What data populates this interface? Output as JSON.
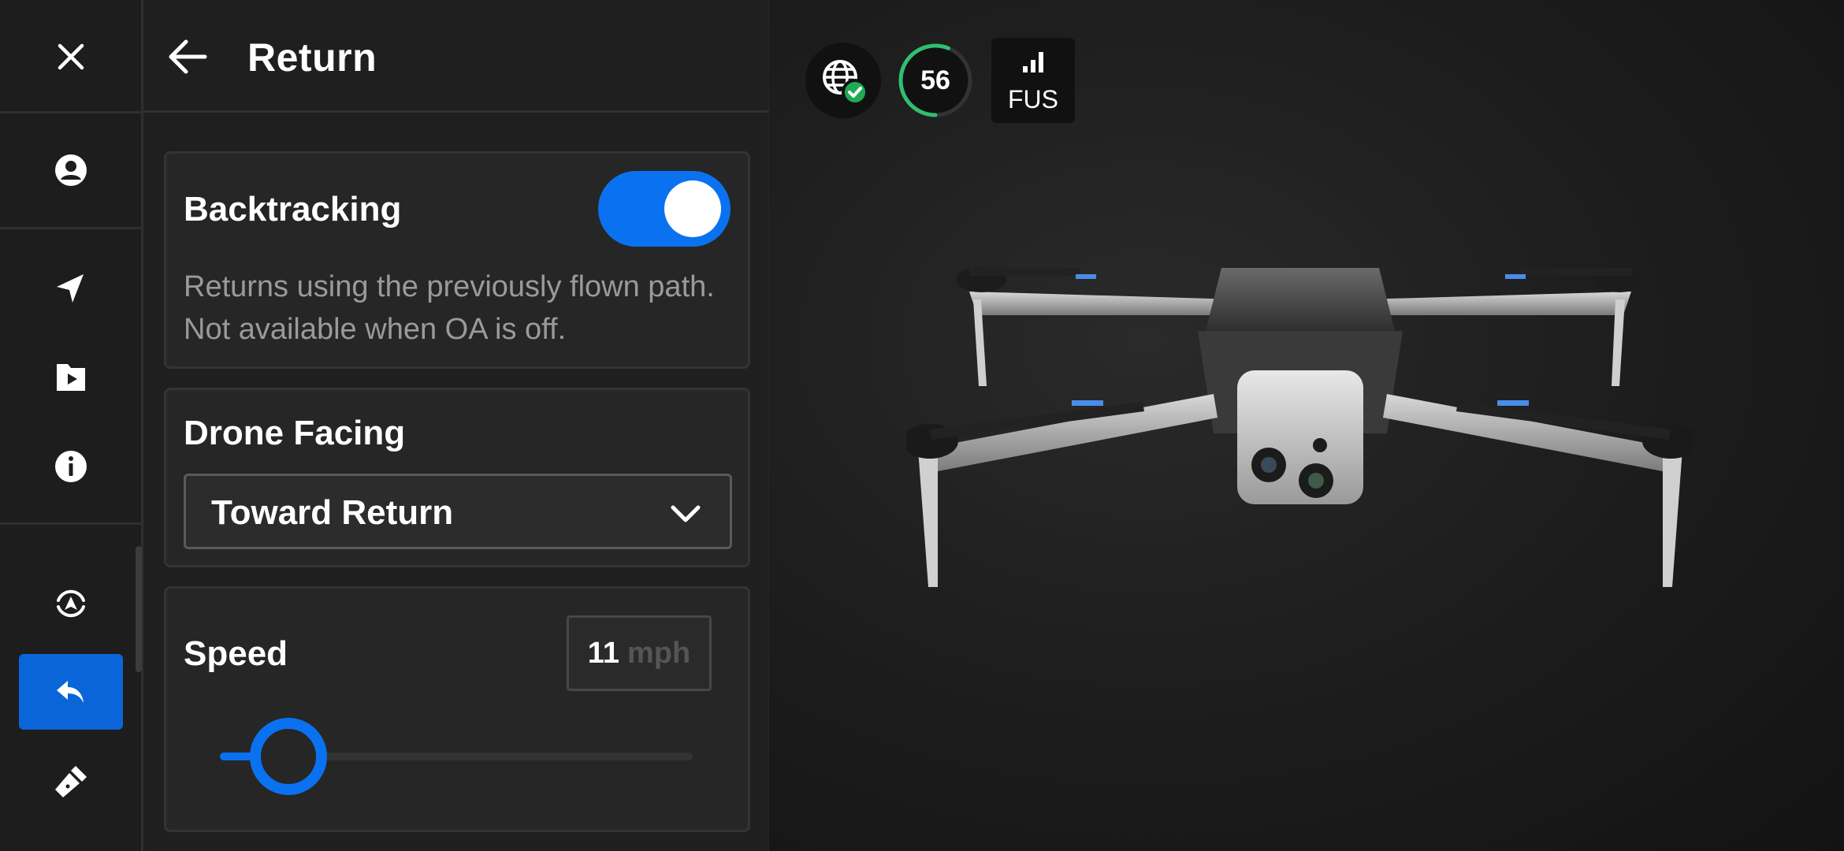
{
  "rail": {
    "items": [
      {
        "name": "close",
        "icon": "close-icon"
      },
      {
        "name": "account",
        "icon": "account-icon"
      },
      {
        "name": "navigation",
        "icon": "navigation-arrow-icon"
      },
      {
        "name": "media",
        "icon": "media-file-icon"
      },
      {
        "name": "info",
        "icon": "info-icon"
      },
      {
        "name": "obstacle-avoidance",
        "icon": "obstacle-avoidance-icon"
      },
      {
        "name": "return",
        "icon": "return-arrow-icon",
        "active": true
      },
      {
        "name": "flashlight",
        "icon": "flashlight-icon"
      }
    ]
  },
  "panel": {
    "title": "Return",
    "backtracking": {
      "label": "Backtracking",
      "enabled": true,
      "description": "Returns using the previously flown path. Not available when OA is off."
    },
    "drone_facing": {
      "label": "Drone Facing",
      "selected": "Toward Return"
    },
    "speed": {
      "label": "Speed",
      "value": "11",
      "unit": "mph",
      "slider_fraction": 0.145
    }
  },
  "status": {
    "gps_icon": "globe-check-icon",
    "battery": "56",
    "battery_fraction": 0.56,
    "battery_color": "#2fbf71",
    "signal_icon": "signal-bars-icon",
    "signal_label": "FUS"
  },
  "colors": {
    "accent": "#0a72f0",
    "active_rail": "#0a66d8",
    "gps_ok": "#1faa55"
  }
}
